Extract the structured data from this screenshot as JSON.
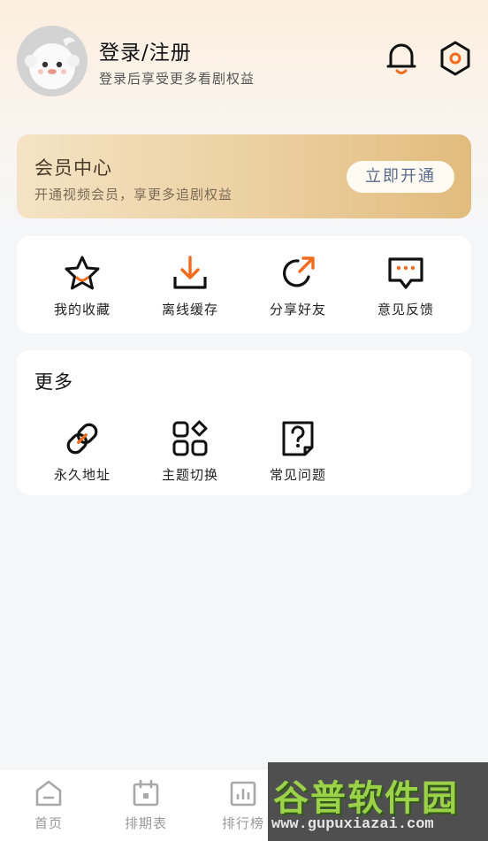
{
  "profile": {
    "login_title": "登录/注册",
    "login_subtitle": "登录后享受更多看剧权益"
  },
  "header_icons": [
    "bell-icon",
    "settings-hex-icon"
  ],
  "vip": {
    "title": "会员中心",
    "subtitle": "开通视频会员，享更多追剧权益",
    "button_label": "立即开通"
  },
  "tools": [
    {
      "label": "我的收藏",
      "icon": "star-icon"
    },
    {
      "label": "离线缓存",
      "icon": "download-icon"
    },
    {
      "label": "分享好友",
      "icon": "share-icon"
    },
    {
      "label": "意见反馈",
      "icon": "feedback-icon"
    }
  ],
  "more": {
    "title": "更多",
    "items": [
      {
        "label": "永久地址",
        "icon": "link-icon"
      },
      {
        "label": "主题切换",
        "icon": "theme-icon"
      },
      {
        "label": "常见问题",
        "icon": "faq-icon"
      }
    ]
  },
  "tabbar": {
    "tabs": [
      {
        "label": "首页",
        "icon": "home-icon"
      },
      {
        "label": "排期表",
        "icon": "calendar-icon"
      },
      {
        "label": "排行榜",
        "icon": "ranking-icon"
      }
    ]
  },
  "watermark": {
    "brand": "谷普软件园",
    "url": "www.gupuxiazai.com"
  },
  "colors": {
    "accent_orange": "#f26a1b",
    "vip_gold_start": "#f4e3c4",
    "vip_gold_end": "#e2bc7e",
    "vip_button_text": "#5a6c8a",
    "tab_inactive": "#999999"
  }
}
